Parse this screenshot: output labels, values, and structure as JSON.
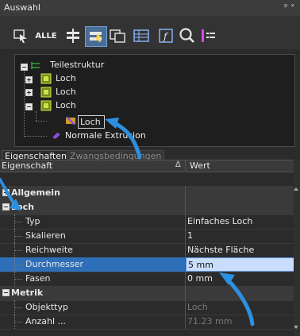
{
  "panel": {
    "title": "Auswahl",
    "pin_glyph": "ᵖ ˣ"
  },
  "toolbar": {
    "alle_label": "ALLE",
    "icons": [
      "select-filter-icon",
      "all-icon",
      "distribute-icon",
      "highlight-select-icon",
      "preview-icon",
      "table-icon",
      "formula-icon",
      "search-icon",
      "list-filter-icon"
    ]
  },
  "tree": {
    "root": "Teilestruktur",
    "items": [
      "Loch",
      "Loch",
      "Loch"
    ],
    "child_selected": "Loch",
    "extrusion": "Normale Extrusion"
  },
  "tabs": {
    "active": "Eigenschaften",
    "inactive": "Zwangsbedingungen"
  },
  "grid": {
    "col_property": "Eigenschaft",
    "sort_glyph": "∆",
    "col_value": "Wert",
    "rows": [
      {
        "kind": "group",
        "label": "Allgemein",
        "value": "",
        "expanded": false
      },
      {
        "kind": "group",
        "label": "Loch",
        "value": "",
        "expanded": true
      },
      {
        "kind": "prop",
        "label": "Typ",
        "value": "Einfaches Loch"
      },
      {
        "kind": "prop",
        "label": "Skalieren",
        "value": "1"
      },
      {
        "kind": "prop",
        "label": "Reichweite",
        "value": "Nächste Fläche"
      },
      {
        "kind": "prop",
        "label": "Durchmesser",
        "value": "5 mm",
        "selected": true
      },
      {
        "kind": "prop",
        "label": "Fasen",
        "value": "0 mm"
      },
      {
        "kind": "group",
        "label": "Metrik",
        "value": "",
        "expanded": true
      },
      {
        "kind": "prop",
        "label": "Objekttyp",
        "value": "Loch",
        "muted": true
      },
      {
        "kind": "prop",
        "label": "Anzahl ...",
        "value": "71.23 mm",
        "muted": true
      }
    ]
  },
  "colors": {
    "selected_row": "#2f6fb8",
    "selected_value_bg": "#c9defc",
    "accent_arrow": "#2c8fe0"
  }
}
